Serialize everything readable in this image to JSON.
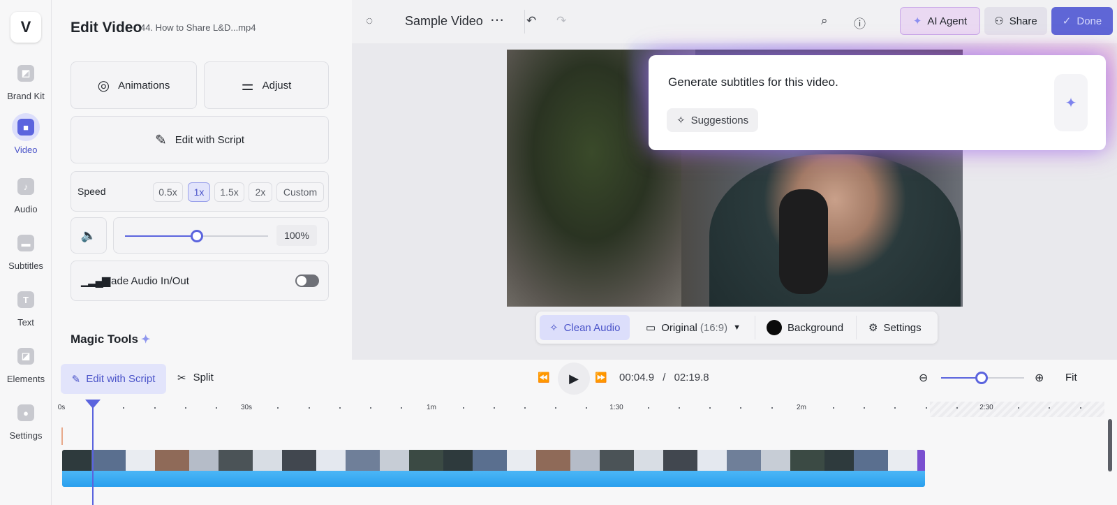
{
  "rail": {
    "logo": "V",
    "items": [
      {
        "label": "Brand Kit",
        "icon": "brand-kit-icon"
      },
      {
        "label": "Video",
        "icon": "video-icon"
      },
      {
        "label": "Audio",
        "icon": "music-note-icon"
      },
      {
        "label": "Subtitles",
        "icon": "subtitles-icon"
      },
      {
        "label": "Text",
        "icon": "text-icon"
      },
      {
        "label": "Elements",
        "icon": "elements-icon"
      },
      {
        "label": "Settings",
        "icon": "settings-icon"
      }
    ],
    "active": "Video"
  },
  "panel": {
    "title": "Edit Video",
    "subtitle": "44. How to Share L&D...mp4",
    "animations": "Animations",
    "adjust": "Adjust",
    "edit_script": "Edit with Script",
    "speed": {
      "label": "Speed",
      "options": [
        "0.5x",
        "1x",
        "1.5x",
        "2x",
        "Custom"
      ],
      "selected": "1x"
    },
    "volume": {
      "value_label": "100%",
      "level": 0.5
    },
    "fade": {
      "label": "Fade Audio In/Out",
      "enabled": false
    },
    "magic_tools": "Magic Tools"
  },
  "topbar": {
    "title": "Sample Video",
    "ai_agent": "AI Agent",
    "share": "Share",
    "done": "Done"
  },
  "prompt": {
    "text": "Generate subtitles for this video.",
    "suggestions": "Suggestions"
  },
  "video_toolbar": {
    "clean_audio": "Clean Audio",
    "ratio_label": "Original",
    "ratio_value": "(16:9)",
    "background": "Background",
    "settings": "Settings"
  },
  "timeline": {
    "edit_script": "Edit with Script",
    "split": "Split",
    "current_time": "00:04.9",
    "separator": "/",
    "total_time": "02:19.8",
    "fit": "Fit",
    "zoom_level": 0.49,
    "ruler_labels": [
      "0s",
      "30s",
      "1m",
      "1:30",
      "2m",
      "2:30"
    ]
  },
  "colors": {
    "accent": "#5b64de",
    "audio_track": "#2aa0ee"
  }
}
